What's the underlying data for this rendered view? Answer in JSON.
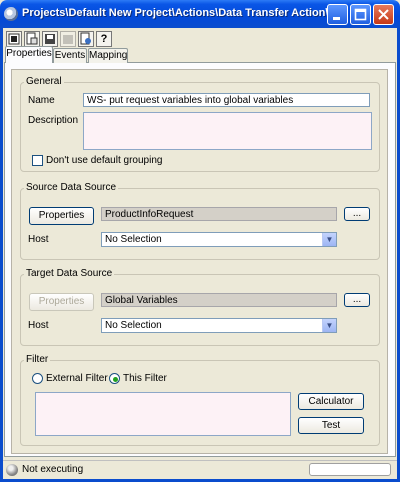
{
  "window": {
    "title": "Projects\\Default New Project\\Actions\\Data Transfer Action\\WS- put reque...",
    "controls": [
      "minimize-icon",
      "maximize-icon",
      "close-icon"
    ]
  },
  "toolbar": {
    "icons": [
      "properties-icon",
      "new-doc-icon",
      "save-icon",
      "delete-icon",
      "run-icon",
      "help-icon"
    ],
    "help_glyph": "?"
  },
  "tabs": [
    {
      "label": "Properties",
      "active": true
    },
    {
      "label": "Events",
      "active": false
    },
    {
      "label": "Mapping",
      "active": false
    }
  ],
  "general": {
    "legend": "General",
    "name_label": "Name",
    "name_value": "WS- put request variables into global variables",
    "description_label": "Description",
    "description_value": "",
    "default_grouping_label": "Don't use default grouping",
    "default_grouping_checked": false
  },
  "source": {
    "legend": "Source Data Source",
    "properties_button": "Properties",
    "source_value": "ProductInfoRequest",
    "browse_button": "...",
    "host_label": "Host",
    "host_value": "No Selection"
  },
  "target": {
    "legend": "Target Data Source",
    "properties_button": "Properties",
    "target_value": "Global Variables",
    "browse_button": "...",
    "host_label": "Host",
    "host_value": "No Selection"
  },
  "filter": {
    "legend": "Filter",
    "external_label": "External Filter",
    "this_label": "This Filter",
    "selected": "This Filter",
    "expression": "",
    "calculator_button": "Calculator",
    "test_button": "Test"
  },
  "status": {
    "text": "Not executing"
  },
  "colors": {
    "titlebar": "#0a56e6",
    "window_bg": "#ece9d8",
    "field_border": "#7f9db9"
  }
}
